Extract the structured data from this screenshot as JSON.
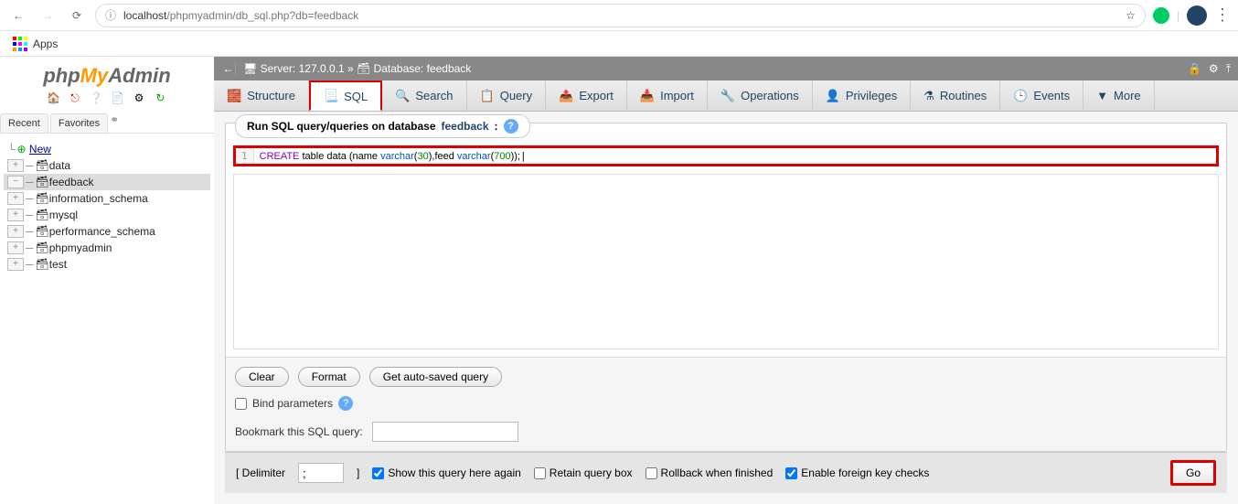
{
  "browser": {
    "url_prefix": "localhost",
    "url_path": "/phpmyadmin/db_sql.php?db=feedback",
    "apps_label": "Apps"
  },
  "logo": {
    "p1": "php",
    "p2": "My",
    "p3": "Admin"
  },
  "sidebar_tabs": {
    "recent": "Recent",
    "favorites": "Favorites"
  },
  "db_tree": {
    "new": "New",
    "items": [
      "data",
      "feedback",
      "information_schema",
      "mysql",
      "performance_schema",
      "phpmyadmin",
      "test"
    ],
    "selected": "feedback"
  },
  "breadcrumb": {
    "server_label": "Server: 127.0.0.1",
    "db_label": "Database: feedback"
  },
  "tabs": {
    "structure": "Structure",
    "sql": "SQL",
    "search": "Search",
    "query": "Query",
    "export": "Export",
    "import": "Import",
    "operations": "Operations",
    "privileges": "Privileges",
    "routines": "Routines",
    "events": "Events",
    "more": "More"
  },
  "panel": {
    "title_prefix": "Run SQL query/queries on database ",
    "title_link": "feedback",
    "title_suffix": ":"
  },
  "sql_code": {
    "line_no": "1",
    "kw1": "CREATE",
    "w1": " table data (name ",
    "ty1": "varchar",
    "p1": "(",
    "n1": "30",
    "p2": "),feed ",
    "ty2": "varchar",
    "p3": "(",
    "n2": "700",
    "p4": "));"
  },
  "buttons": {
    "clear": "Clear",
    "format": "Format",
    "autosave": "Get auto-saved query"
  },
  "bind_params": "Bind parameters",
  "bookmark_label": "Bookmark this SQL query:",
  "bottom": {
    "delimiter_label_open": "[ Delimiter",
    "delimiter_value": ";",
    "delimiter_label_close": "]",
    "show_again": "Show this query here again",
    "retain": "Retain query box",
    "rollback": "Rollback when finished",
    "fk": "Enable foreign key checks",
    "go": "Go"
  }
}
